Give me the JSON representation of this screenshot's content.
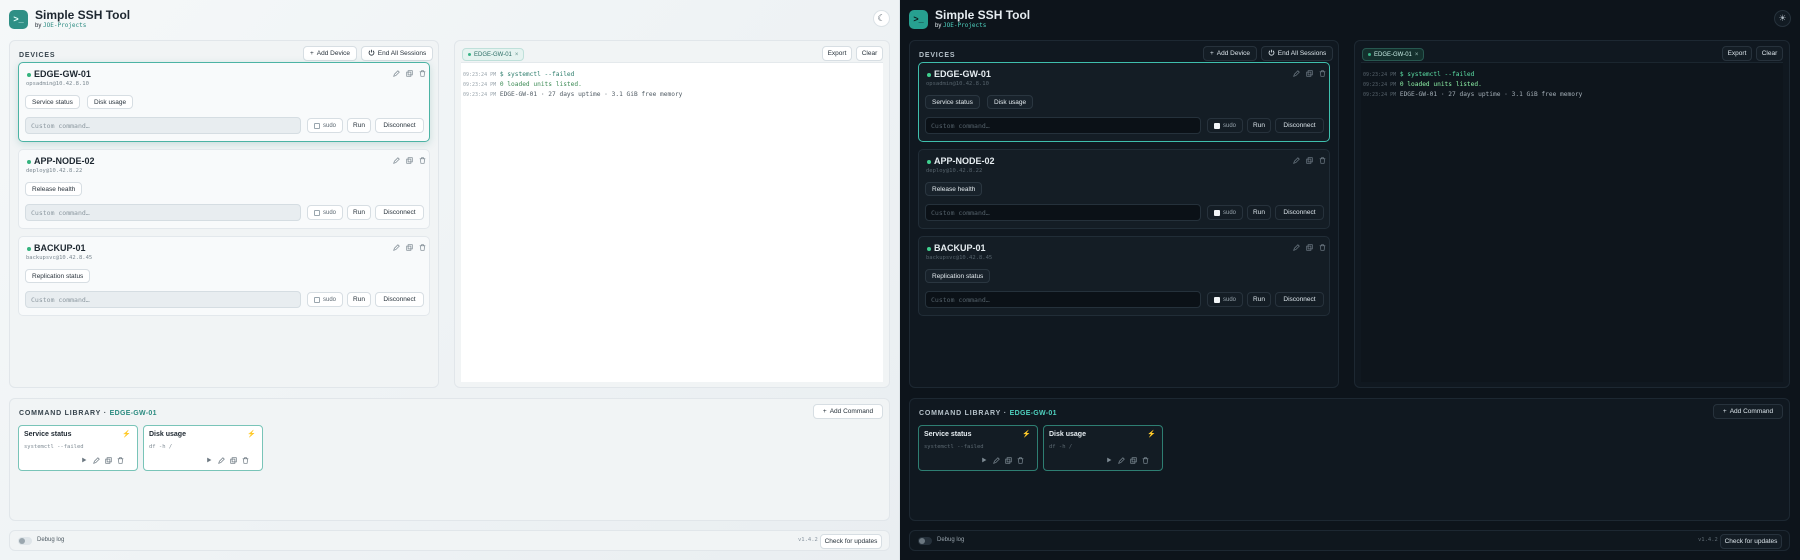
{
  "app": {
    "title": "Simple SSH Tool",
    "by_prefix": "by",
    "by_user": "JOE-Projects"
  },
  "icons": {
    "logo": "terminal-icon",
    "theme_light": "moon-icon",
    "theme_dark": "sun-icon",
    "edit": "pencil-icon",
    "copy": "copy-icon",
    "delete": "trash-icon",
    "run": "play-icon",
    "bolt": "bolt-icon",
    "plus": "plus-icon",
    "power": "power-icon"
  },
  "devices": {
    "title": "DEVICES",
    "add_label": "Add Device",
    "end_label": "End All Sessions",
    "items": [
      {
        "name": "EDGE-GW-01",
        "address": "opsadmin@10.42.8.10",
        "chips": [
          "Service status",
          "Disk usage"
        ],
        "placeholder": "Custom command…",
        "sudo_label": "sudo",
        "run_label": "Run",
        "disconnect_label": "Disconnect",
        "selected": true
      },
      {
        "name": "APP-NODE-02",
        "address": "deploy@10.42.8.22",
        "chips": [
          "Release health"
        ],
        "placeholder": "Custom command…",
        "sudo_label": "sudo",
        "run_label": "Run",
        "disconnect_label": "Disconnect",
        "selected": false
      },
      {
        "name": "BACKUP-01",
        "address": "backupsvc@10.42.8.45",
        "chips": [
          "Replication status"
        ],
        "placeholder": "Custom command…",
        "sudo_label": "sudo",
        "run_label": "Run",
        "disconnect_label": "Disconnect",
        "selected": false
      }
    ]
  },
  "terminal": {
    "tab_label": "EDGE-GW-01",
    "close_glyph": "×",
    "export_label": "Export",
    "clear_label": "Clear",
    "lines": [
      {
        "time": "09:23:24 PM",
        "text": "$ systemctl --failed"
      },
      {
        "time": "09:23:24 PM",
        "text": "0 loaded units listed."
      },
      {
        "time": "09:23:24 PM",
        "text": "EDGE-GW-01 · 27 days uptime · 3.1 GiB free memory"
      }
    ]
  },
  "library": {
    "title": "COMMAND LIBRARY ·",
    "device": "EDGE-GW-01",
    "add_label": "Add Command",
    "items": [
      {
        "name": "Service status",
        "command": "systemctl --failed"
      },
      {
        "name": "Disk usage",
        "command": "df -h /"
      }
    ]
  },
  "footer": {
    "debug_label": "Debug log",
    "version": "v1.4.2",
    "update_label": "Check for updates"
  },
  "colors": {
    "accent_light": "#2b8b80",
    "accent_dark": "#4fd1bf",
    "status_green": "#34b37e"
  }
}
